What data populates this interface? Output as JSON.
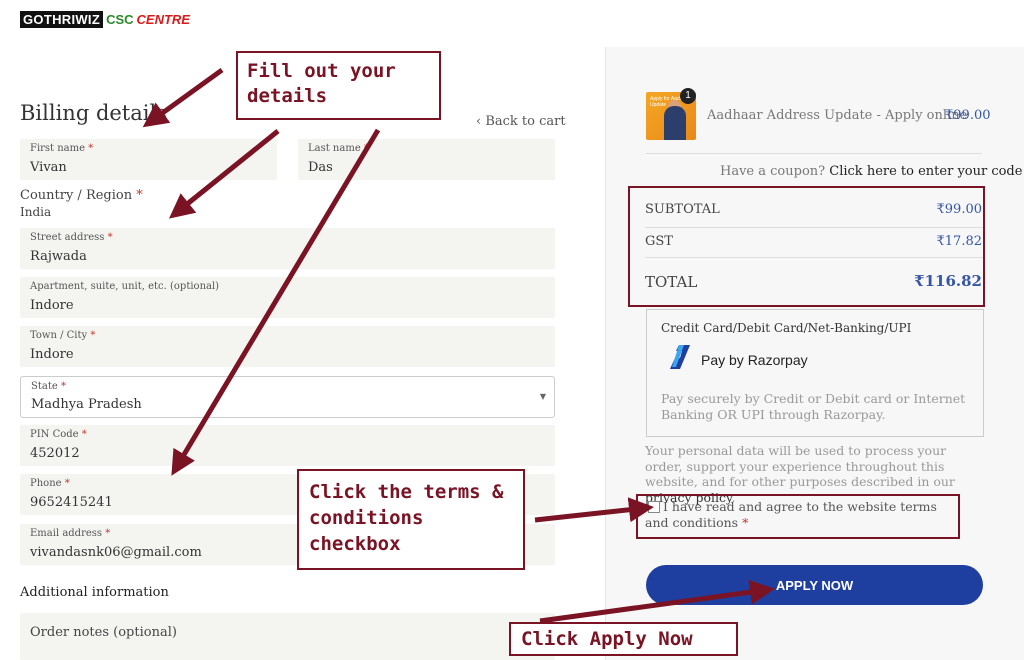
{
  "logo": {
    "part1": "GOTHRIWIZ",
    "part2": "CSC",
    "part3": "CENTRE"
  },
  "billing": {
    "heading": "Billing details",
    "back_to_cart": "‹  Back to cart",
    "first_name": {
      "label": "First name",
      "value": "Vivan"
    },
    "last_name": {
      "label": "Last name",
      "value": "Das"
    },
    "country": {
      "label": "Country / Region",
      "value": "India"
    },
    "street": {
      "label": "Street address",
      "value": "Rajwada"
    },
    "apartment": {
      "label": "Apartment, suite, unit, etc. (optional)",
      "value": "Indore"
    },
    "town": {
      "label": "Town / City",
      "value": "Indore"
    },
    "state": {
      "label": "State",
      "value": "Madhya Pradesh"
    },
    "pin": {
      "label": "PIN Code",
      "value": "452012"
    },
    "phone": {
      "label": "Phone",
      "value": "9652415241"
    },
    "email": {
      "label": "Email address",
      "value": "vivandasnk06@gmail.com"
    },
    "required_mark": "*",
    "additional_heading": "Additional information",
    "order_notes_placeholder": "Order notes (optional)"
  },
  "order": {
    "product": {
      "qty_badge": "1",
      "name": "Aadhaar Address Update - Apply online",
      "price": "₹99.00",
      "thumb_text": "Apply for Aadhaar Update"
    },
    "coupon_prefix": "Have a coupon?",
    "coupon_link": "Click here to enter your code",
    "subtotal_label": "SUBTOTAL",
    "subtotal_value": "₹99.00",
    "gst_label": "GST",
    "gst_value": "₹17.82",
    "total_label": "TOTAL",
    "total_value": "₹116.82"
  },
  "payment": {
    "method_title": "Credit Card/Debit Card/Net-Banking/UPI",
    "provider": "Pay by Razorpay",
    "description": "Pay securely by Credit or Debit card or Internet Banking OR UPI through Razorpay."
  },
  "privacy": {
    "text": "Your personal data will be used to process your order, support your experience throughout this website, and for other purposes described in our",
    "link": "privacy policy",
    "end": "."
  },
  "terms": {
    "text": "I have read and agree to the website terms and conditions",
    "required": "*"
  },
  "apply_button": "APPLY NOW",
  "annotations": {
    "fill_details": "Fill out your details",
    "click_terms": "Click the terms & conditions checkbox",
    "click_apply": "Click Apply Now",
    "color": "#7a1424"
  },
  "colors": {
    "accent": "#1e3fa0",
    "price": "#3555a5",
    "annotation": "#7a1424"
  }
}
